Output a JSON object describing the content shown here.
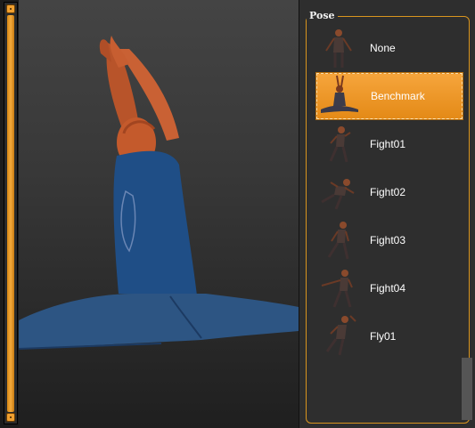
{
  "panel": {
    "title": "Pose",
    "items": [
      {
        "label": "None",
        "selected": false
      },
      {
        "label": "Benchmark",
        "selected": true
      },
      {
        "label": "Fight01",
        "selected": false
      },
      {
        "label": "Fight02",
        "selected": false
      },
      {
        "label": "Fight03",
        "selected": false
      },
      {
        "label": "Fight04",
        "selected": false
      },
      {
        "label": "Fly01",
        "selected": false
      }
    ]
  },
  "colors": {
    "accent": "#f0a030",
    "panel_bg": "#2e2e2e",
    "viewport_bg": "#3a3a3a",
    "shirt": "#1f4e86",
    "skin": "#c2592b"
  }
}
